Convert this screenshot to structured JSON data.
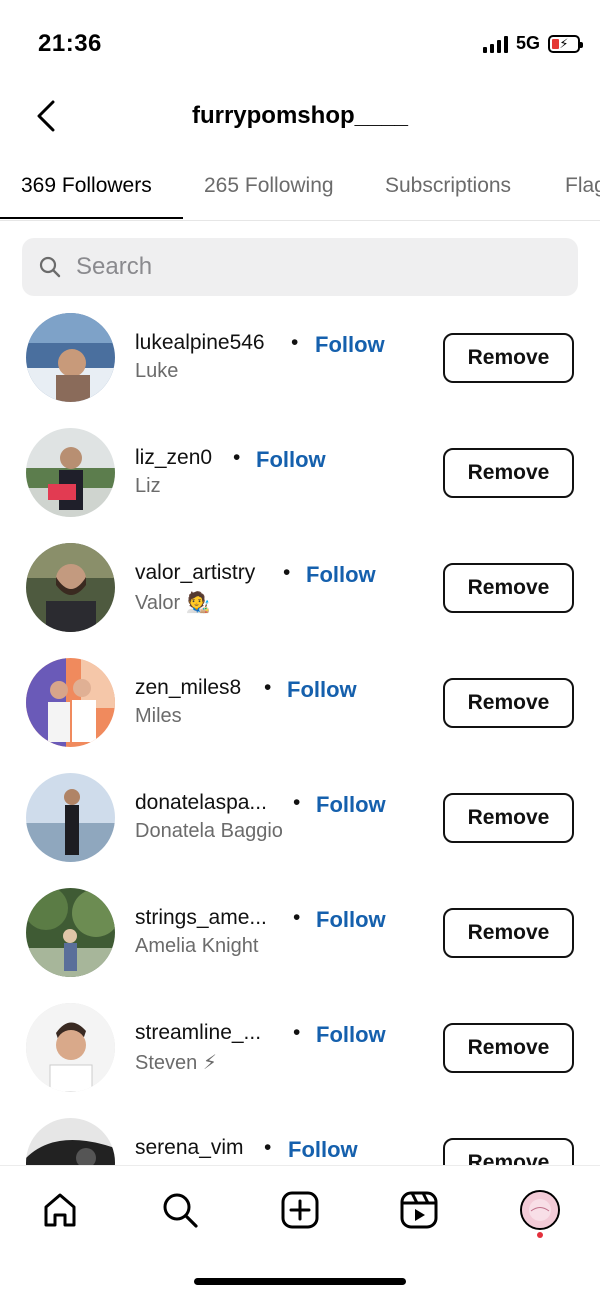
{
  "status_bar": {
    "time": "21:36",
    "network": "5G",
    "battery_bolt": "⚡"
  },
  "header": {
    "back_icon": "chevron-left-icon",
    "title": "furrypomshop____"
  },
  "tabs": [
    {
      "label": "369 Followers",
      "active": true
    },
    {
      "label": "265 Following",
      "active": false
    },
    {
      "label": "Subscriptions",
      "active": false
    },
    {
      "label": "Flagged",
      "active": false
    }
  ],
  "search": {
    "placeholder": "Search",
    "icon": "search-icon"
  },
  "followers": [
    {
      "username": "lukealpine546",
      "name": "Luke",
      "follow_label": "Follow",
      "remove_label": "Remove",
      "dot": "•"
    },
    {
      "username": "liz_zen0",
      "name": "Liz",
      "follow_label": "Follow",
      "remove_label": "Remove",
      "dot": "•"
    },
    {
      "username": "valor_artistry",
      "name": "Valor 🧑‍🎨",
      "follow_label": "Follow",
      "remove_label": "Remove",
      "dot": "•"
    },
    {
      "username": "zen_miles8",
      "name": "Miles",
      "follow_label": "Follow",
      "remove_label": "Remove",
      "dot": "•"
    },
    {
      "username": "donatelaspa...",
      "name": "Donatela Baggio",
      "follow_label": "Follow",
      "remove_label": "Remove",
      "dot": "•"
    },
    {
      "username": "strings_ame...",
      "name": "Amelia Knight",
      "follow_label": "Follow",
      "remove_label": "Remove",
      "dot": "•"
    },
    {
      "username": "streamline_...",
      "name": "Steven ⚡",
      "follow_label": "Follow",
      "remove_label": "Remove",
      "dot": "•"
    },
    {
      "username": "serena_vim",
      "name": "",
      "follow_label": "Follow",
      "remove_label": "Remove",
      "dot": "•"
    }
  ],
  "bottom_nav": {
    "items": [
      "home-icon",
      "search-icon",
      "create-post-icon",
      "reels-icon",
      "profile-avatar"
    ],
    "notification_dot_color": "#e3303c"
  },
  "colors": {
    "follow_link": "#1560ad",
    "secondary_text": "#6b6b6b",
    "search_bg": "#efeff0"
  }
}
